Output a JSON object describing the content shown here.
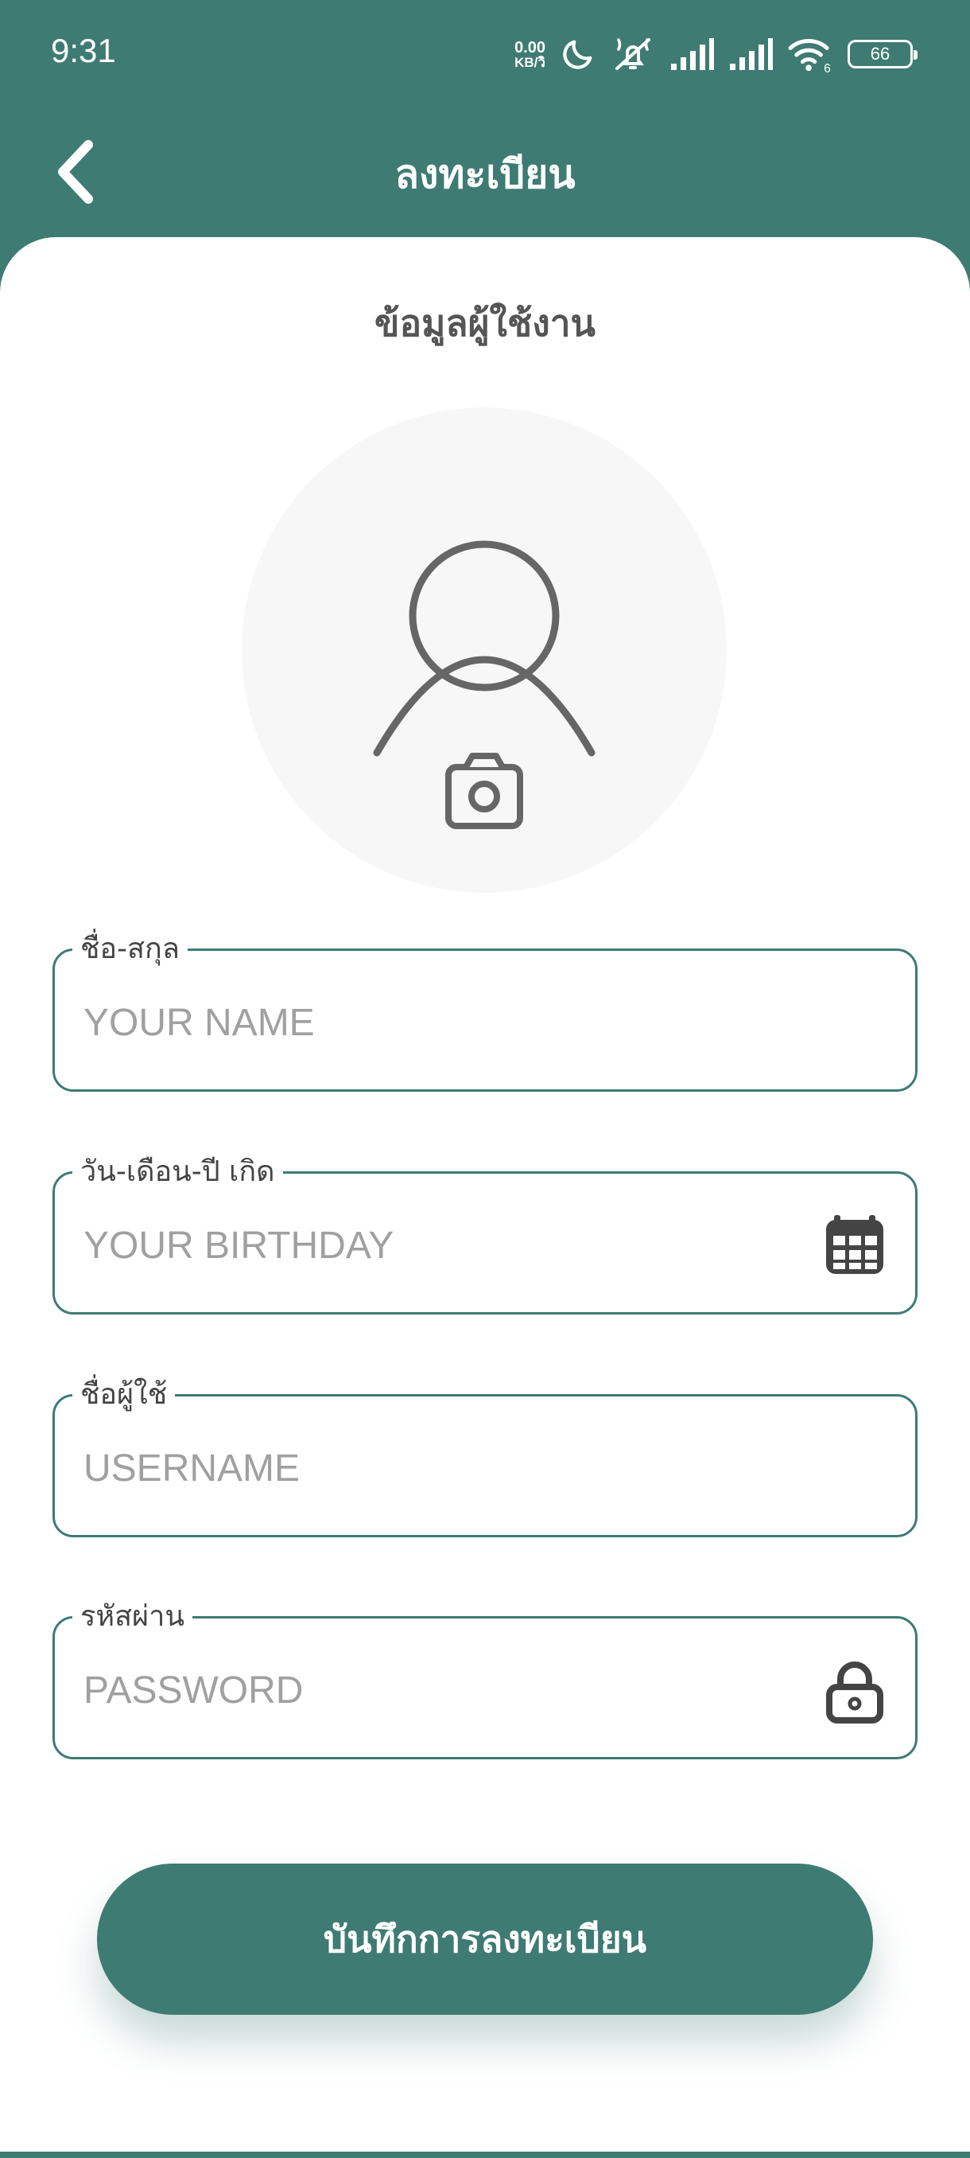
{
  "status_bar": {
    "time": "9:31",
    "net_speed_value": "0.00",
    "net_speed_unit": "KB/วิ",
    "battery": "66",
    "wifi_badge": "6",
    "icons": [
      "moon-icon",
      "bell-off-icon",
      "signal-icon",
      "signal-icon",
      "wifi-icon",
      "battery-icon"
    ]
  },
  "header": {
    "title": "ลงทะเบียน",
    "back_icon": "chevron-left-icon"
  },
  "form": {
    "section_title": "ข้อมูลผู้ใช้งาน",
    "avatar_icons": [
      "user-icon",
      "camera-icon"
    ],
    "fields": [
      {
        "label": "ชื่อ-สกุล",
        "placeholder": "YOUR NAME",
        "value": "",
        "icon": ""
      },
      {
        "label": "วัน-เดือน-ปี เกิด",
        "placeholder": "YOUR BIRTHDAY",
        "value": "",
        "icon": "calendar-icon"
      },
      {
        "label": "ชื่อผู้ใช้",
        "placeholder": "USERNAME",
        "value": "",
        "icon": ""
      },
      {
        "label": "รหัสผ่าน",
        "placeholder": "PASSWORD",
        "value": "",
        "icon": "lock-icon"
      }
    ],
    "submit_label": "บันทึกการลงทะเบียน"
  },
  "colors": {
    "primary": "#3e7b73",
    "surface": "#ffffff",
    "avatar_bg": "#f7f7f7",
    "placeholder": "#a0a0a0",
    "icon": "#444444"
  }
}
